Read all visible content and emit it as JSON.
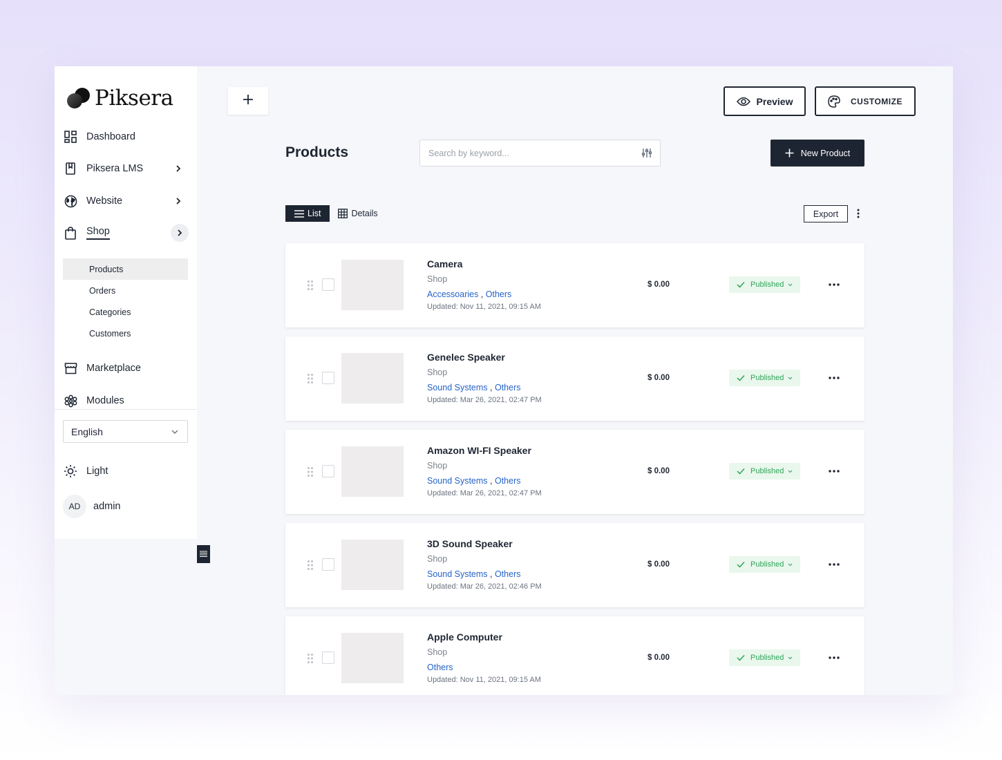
{
  "brand": {
    "name": "Piksera"
  },
  "sidebar": {
    "items": [
      {
        "label": "Dashboard",
        "icon": "dashboard-icon"
      },
      {
        "label": "Piksera LMS",
        "icon": "book-icon"
      },
      {
        "label": "Website",
        "icon": "globe-icon"
      },
      {
        "label": "Shop",
        "icon": "shopping-bag-icon"
      },
      {
        "label": "Marketplace",
        "icon": "store-icon"
      },
      {
        "label": "Modules",
        "icon": "modules-icon"
      }
    ],
    "shop_subitems": [
      {
        "label": "Products"
      },
      {
        "label": "Orders"
      },
      {
        "label": "Categories"
      },
      {
        "label": "Customers"
      }
    ],
    "language": "English",
    "theme": "Light",
    "user": {
      "initials": "AD",
      "name": "admin"
    }
  },
  "topbar": {
    "preview_label": "Preview",
    "customize_label": "CUSTOMIZE"
  },
  "products_page": {
    "title": "Products",
    "search_placeholder": "Search by keyword...",
    "new_button": "New Product",
    "view_list": "List",
    "view_details": "Details",
    "export": "Export"
  },
  "products": [
    {
      "name": "Camera",
      "shop": "Shop",
      "categories": [
        "Accessoaries",
        "Others"
      ],
      "updated": "Updated: Nov 11, 2021, 09:15 AM",
      "price": "$ 0.00",
      "status": "Published"
    },
    {
      "name": "Genelec Speaker",
      "shop": "Shop",
      "categories": [
        "Sound Systems",
        "Others"
      ],
      "updated": "Updated: Mar 26, 2021, 02:47 PM",
      "price": "$ 0.00",
      "status": "Published"
    },
    {
      "name": "Amazon WI-FI Speaker",
      "shop": "Shop",
      "categories": [
        "Sound Systems",
        "Others"
      ],
      "updated": "Updated: Mar 26, 2021, 02:47 PM",
      "price": "$ 0.00",
      "status": "Published"
    },
    {
      "name": "3D Sound Speaker",
      "shop": "Shop",
      "categories": [
        "Sound Systems",
        "Others"
      ],
      "updated": "Updated: Mar 26, 2021, 02:46 PM",
      "price": "$ 0.00",
      "status": "Published"
    },
    {
      "name": "Apple Computer",
      "shop": "Shop",
      "categories": [
        "Others"
      ],
      "updated": "Updated: Nov 11, 2021, 09:15 AM",
      "price": "$ 0.00",
      "status": "Published"
    }
  ],
  "colors": {
    "primary_dark": "#1e2532",
    "link_blue": "#2563c9",
    "published_green": "#2fa55a",
    "published_bg": "#e9f7ec"
  }
}
